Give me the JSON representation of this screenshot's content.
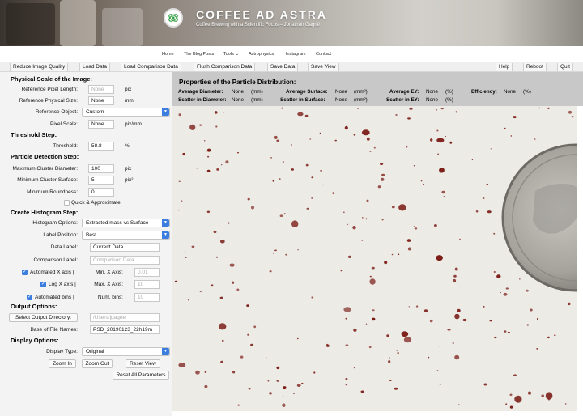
{
  "header": {
    "site_title": "COFFEE AD ASTRA",
    "tagline": "Coffee Brewing with a Scientific Focus – Jonathan Gagné"
  },
  "nav": {
    "items": [
      "Home",
      "The Blog Posts",
      "Tools",
      "Astrophysics",
      "Instagram",
      "Contact"
    ]
  },
  "toolbar": {
    "reduce_quality": "Reduce Image Quality",
    "load_data": "Load Data",
    "load_comparison": "Load Comparison Data",
    "flush_comparison": "Flush Comparison Data",
    "save_data": "Save Data",
    "save_view": "Save View",
    "help": "Help",
    "reboot": "Reboot",
    "quit": "Quit"
  },
  "physical_scale": {
    "title": "Physical Scale of the Image:",
    "ref_pixel_length_label": "Reference Pixel Length:",
    "ref_pixel_length_value": "None",
    "ref_pixel_length_unit": "pix",
    "ref_physical_size_label": "Reference Physical Size:",
    "ref_physical_size_value": "None",
    "ref_physical_size_unit": "mm",
    "ref_object_label": "Reference Object:",
    "ref_object_value": "Custom",
    "pixel_scale_label": "Pixel Scale:",
    "pixel_scale_value": "None",
    "pixel_scale_unit": "pix/mm"
  },
  "threshold": {
    "title": "Threshold Step:",
    "label": "Threshold:",
    "value": "58.8",
    "unit": "%"
  },
  "detection": {
    "title": "Particle Detection Step:",
    "max_diam_label": "Maximum Cluster Diameter:",
    "max_diam_value": "100",
    "max_diam_unit": "pix",
    "min_surf_label": "Minimum Cluster Surface:",
    "min_surf_value": "5",
    "min_surf_unit": "pix²",
    "min_round_label": "Minimum Roundness:",
    "min_round_value": "0",
    "quick_label": "Quick & Approximate"
  },
  "histogram": {
    "title": "Create Histogram Step:",
    "options_label": "Histogram Options:",
    "options_value": "Extracted mass vs Surface",
    "label_pos_label": "Label Position:",
    "label_pos_value": "Best",
    "data_label_label": "Data Label:",
    "data_label_value": "Current Data",
    "comp_label_label": "Comparison Label:",
    "comp_label_value": "Comparison Data",
    "auto_x_label": "Automated X axis |",
    "min_x_label": "Min. X Axis:",
    "min_x_value": "0.01",
    "log_x_label": "Log X axis |",
    "max_x_label": "Max. X Axis:",
    "max_x_value": "10",
    "auto_bins_label": "Automated bins |",
    "num_bins_label": "Num. bins:",
    "num_bins_value": "10"
  },
  "output": {
    "title": "Output Options:",
    "select_dir": "Select Output Directory:",
    "dir_value": "/Users/jgagne",
    "base_name_label": "Base of File Names:",
    "base_name_value": "PSD_20190123_22h19m"
  },
  "display": {
    "title": "Display Options:",
    "type_label": "Display Type:",
    "type_value": "Original",
    "zoom_in": "Zoom In",
    "zoom_out": "Zoom Out",
    "reset_view": "Reset View",
    "reset_all": "Reset All Parameters"
  },
  "properties": {
    "title": "Properties of the Particle Distribution:",
    "avg_diam_label": "Average Diameter:",
    "avg_diam_value": "None",
    "avg_diam_unit": "(mm)",
    "avg_surf_label": "Average Surface:",
    "avg_surf_value": "None",
    "avg_surf_unit": "(mm²)",
    "avg_ey_label": "Average EY:",
    "avg_ey_value": "None",
    "avg_ey_unit": "(%)",
    "eff_label": "Efficiency:",
    "eff_value": "None",
    "eff_unit": "(%)",
    "sc_diam_label": "Scatter in Diameter:",
    "sc_diam_value": "None",
    "sc_diam_unit": "(mm)",
    "sc_surf_label": "Scatter in Surface:",
    "sc_surf_value": "None",
    "sc_surf_unit": "(mm²)",
    "sc_ey_label": "Scatter in EY:",
    "sc_ey_value": "None",
    "sc_ey_unit": "(%)"
  },
  "colors": {
    "accent": "#3b7ee0",
    "panel": "#f3f3f3",
    "properties_bg": "#c8c8c8",
    "particle": "#7a1a14",
    "photo_background": "#ecebe6"
  }
}
